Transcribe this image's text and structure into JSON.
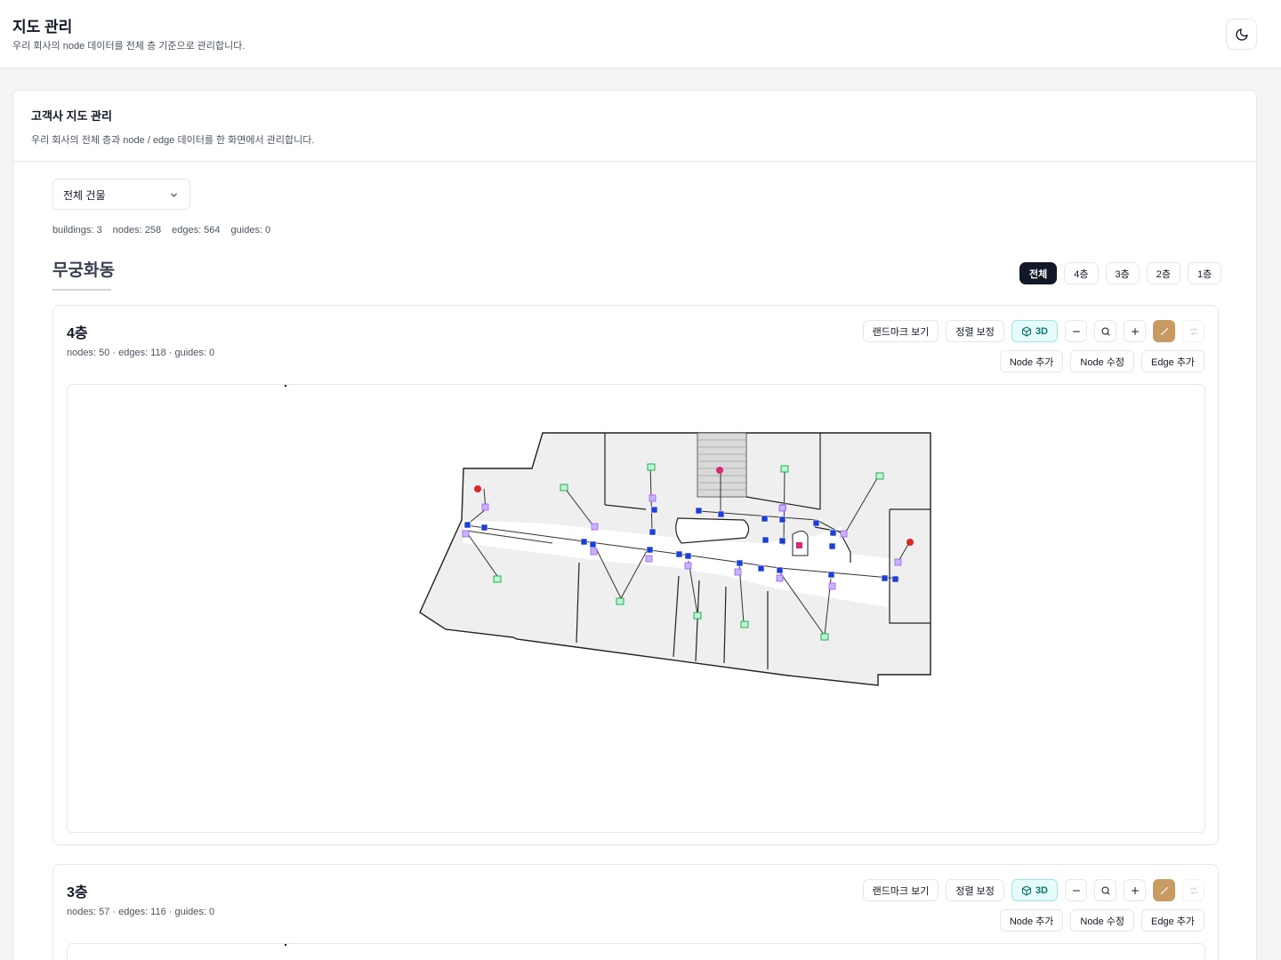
{
  "header": {
    "title": "지도 관리",
    "subtitle": "우리 회사의 node 데이터를 전체 층 기준으로 관리합니다."
  },
  "card": {
    "title": "고객사 지도 관리",
    "description": "우리 회사의 전체 층과 node / edge 데이터를 한 화면에서 관리합니다."
  },
  "building_select": {
    "value": "전체 건물"
  },
  "stats": {
    "buildings": "buildings: 3",
    "nodes": "nodes: 258",
    "edges": "edges: 564",
    "guides": "guides: 0"
  },
  "building": {
    "name": "무궁화동",
    "floor_tabs": [
      "전체",
      "4층",
      "3층",
      "2층",
      "1층"
    ],
    "active_tab": "전체"
  },
  "toolbar": {
    "landmark": "랜드마크 보기",
    "align": "정렬 보정",
    "three_d": "3D",
    "add_node": "Node 추가",
    "edit_node": "Node 수정",
    "add_edge": "Edge 추가"
  },
  "floors": [
    {
      "title": "4층",
      "stats": "nodes: 50 · edges: 118 · guides: 0"
    },
    {
      "title": "3층",
      "stats": "nodes: 57 · edges: 116 · guides: 0"
    }
  ],
  "colors": {
    "accent_dark": "#111827",
    "edit_button": "#c89b63",
    "three_d_bg": "#e6fbfb",
    "node_blue": "#1d3fd8",
    "node_purple": "#a855f7",
    "node_green": "#16a34a",
    "node_red": "#dc2626",
    "node_magenta": "#db2777"
  },
  "icons": [
    "moon-icon",
    "chevron-down-icon",
    "cube-icon",
    "minus-icon",
    "search-icon",
    "plus-icon",
    "pencil-icon",
    "shuffle-icon"
  ]
}
